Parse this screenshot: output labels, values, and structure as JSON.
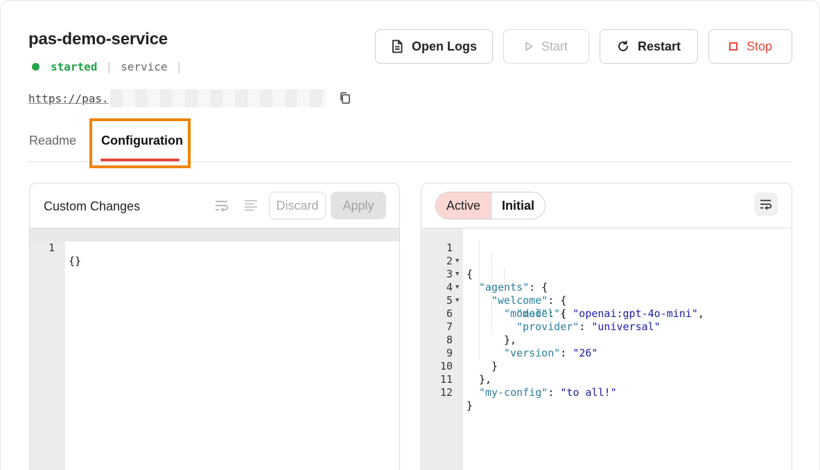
{
  "service": {
    "name": "pas-demo-service",
    "status": "started",
    "kind": "service",
    "separator": "|",
    "url_prefix": "https://pas."
  },
  "actions": {
    "open_logs": "Open Logs",
    "start": "Start",
    "restart": "Restart",
    "stop": "Stop"
  },
  "tabs": [
    {
      "label": "Readme",
      "selected": false
    },
    {
      "label": "Configuration",
      "selected": true
    }
  ],
  "custom_changes": {
    "title": "Custom Changes",
    "discard": "Discard",
    "apply": "Apply",
    "lines": [
      {
        "n": "1",
        "text": "{}"
      }
    ]
  },
  "config_view": {
    "segments": {
      "active": "Active",
      "initial": "Initial"
    },
    "selected_segment": "Active",
    "lines": [
      {
        "n": "1",
        "fold": true
      },
      {
        "n": "2",
        "fold": true,
        "key": "\"agents\"",
        "rest": ": {"
      },
      {
        "n": "3",
        "fold": true,
        "key": "\"welcome\"",
        "rest": ": {"
      },
      {
        "n": "4",
        "fold": true,
        "key": "\"model\"",
        "rest": ": {"
      },
      {
        "n": "5",
        "key": "\"model\"",
        "value": "\"openai:gpt-4o-mini\"",
        "tail": ","
      },
      {
        "n": "6",
        "key": "\"provider\"",
        "value": "\"universal\""
      },
      {
        "n": "7",
        "text": "},"
      },
      {
        "n": "8",
        "key": "\"version\"",
        "value": "\"26\""
      },
      {
        "n": "9",
        "text": "}"
      },
      {
        "n": "10",
        "text": "},"
      },
      {
        "n": "11",
        "key": "\"my-config\"",
        "value": "\"to all!\""
      },
      {
        "n": "12",
        "text": "}"
      }
    ],
    "line1_text": "{"
  },
  "colors": {
    "status_green": "#22a447",
    "stop_red": "#e5483d",
    "tab_highlight": "#ee8400",
    "json_key": "#2a7f9a",
    "json_string": "#1a1aa6"
  },
  "icons": {
    "open_logs": "document-icon",
    "start": "play-icon",
    "restart": "refresh-icon",
    "stop": "stop-square-icon",
    "copy": "copy-icon",
    "wrap": "word-wrap-icon",
    "format": "align-left-icon"
  }
}
